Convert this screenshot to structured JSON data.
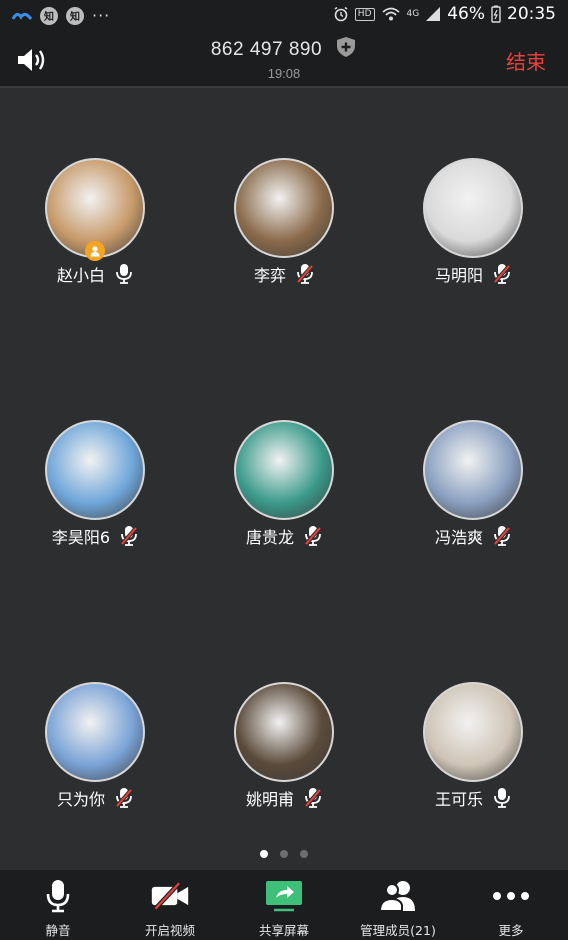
{
  "status_bar": {
    "time": "20:35",
    "battery": "46%",
    "network": "4G",
    "hd": "HD",
    "app_icon_text": "知",
    "more": "···"
  },
  "header": {
    "meeting_id": "862 497 890",
    "duration": "19:08",
    "end_label": "结束"
  },
  "participants": [
    {
      "name": "赵小白",
      "mic": "on",
      "host": true,
      "avatar_bg": "#c79a6a"
    },
    {
      "name": "李弈",
      "mic": "muted",
      "host": false,
      "avatar_bg": "#8a6a4a"
    },
    {
      "name": "马明阳",
      "mic": "muted",
      "host": false,
      "avatar_bg": "#d9d9d9"
    },
    {
      "name": "李昊阳6",
      "mic": "muted",
      "host": false,
      "avatar_bg": "#6fa6d9"
    },
    {
      "name": "唐贵龙",
      "mic": "muted",
      "host": false,
      "avatar_bg": "#3a9a8a"
    },
    {
      "name": "冯浩爽",
      "mic": "muted",
      "host": false,
      "avatar_bg": "#8aa0c0"
    },
    {
      "name": "只为你",
      "mic": "muted",
      "host": false,
      "avatar_bg": "#7aa3d6"
    },
    {
      "name": "姚明甫",
      "mic": "muted",
      "host": false,
      "avatar_bg": "#5a4a3a"
    },
    {
      "name": "王可乐",
      "mic": "on",
      "host": false,
      "avatar_bg": "#cfc4b6"
    }
  ],
  "pagination": {
    "pages": 3,
    "current": 1
  },
  "toolbar": {
    "mute": "静音",
    "video": "开启视频",
    "share": "共享屏幕",
    "members": "管理成员(21)",
    "more": "更多"
  },
  "colors": {
    "accent_end": "#e8413b",
    "host_badge": "#f5a524",
    "share_green": "#3ec07a"
  }
}
